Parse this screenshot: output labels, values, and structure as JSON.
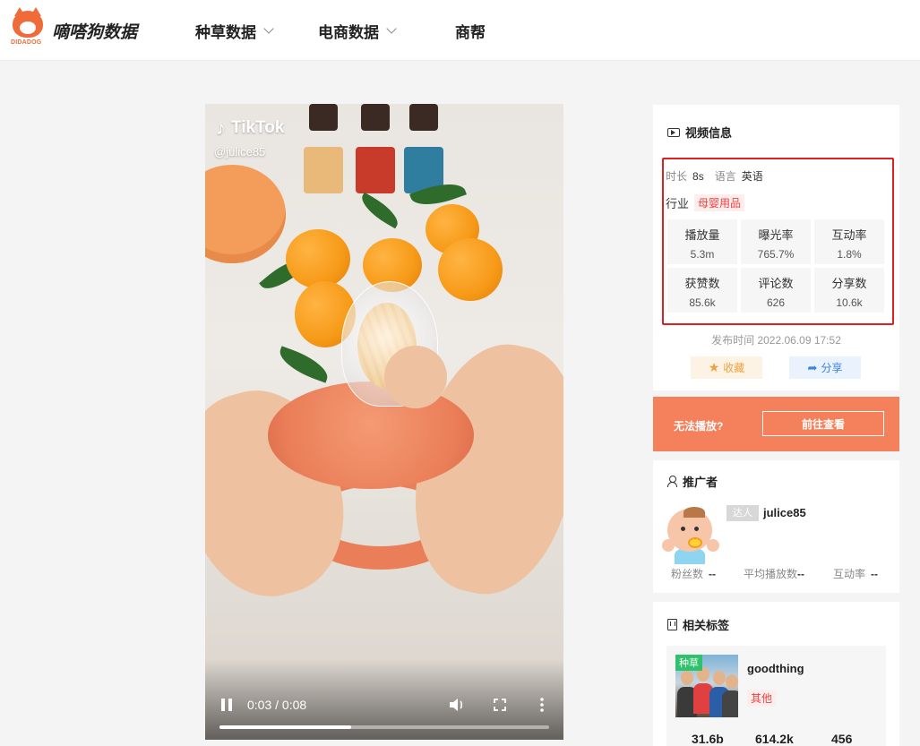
{
  "header": {
    "logo_text": "DIDADOG",
    "brand": "嘀嗒狗数据",
    "nav": [
      {
        "label": "种草数据"
      },
      {
        "label": "电商数据"
      },
      {
        "label": "商帮"
      }
    ]
  },
  "video": {
    "platform": "TikTok",
    "username": "@julice85",
    "time": "0:03 / 0:08",
    "progress": 0.4
  },
  "video_info": {
    "title": "视频信息",
    "duration_label": "时长",
    "duration": "8s",
    "language_label": "语言",
    "language": "英语",
    "industry_label": "行业",
    "industry": "母婴用品",
    "stats": [
      {
        "label": "播放量",
        "value": "5.3m"
      },
      {
        "label": "曝光率",
        "value": "765.7%"
      },
      {
        "label": "互动率",
        "value": "1.8%"
      },
      {
        "label": "获赞数",
        "value": "85.6k"
      },
      {
        "label": "评论数",
        "value": "626"
      },
      {
        "label": "分享数",
        "value": "10.6k"
      }
    ],
    "publish_time": "发布时间 2022.06.09 17:52",
    "favorite_label": "收藏",
    "share_label": "分享"
  },
  "promo": {
    "text": "无法播放?",
    "button": "前往查看"
  },
  "promoter": {
    "title": "推广者",
    "badge": "达人",
    "name": "julice85",
    "fans_label": "粉丝数",
    "fans": "--",
    "avg_play_label": "平均播放数",
    "avg_play": "--",
    "engagement_label": "互动率",
    "engagement": "--"
  },
  "related_tags": {
    "title": "相关标签",
    "items": [
      {
        "badge": "种草",
        "name": "goodthing",
        "category": "其他",
        "stats": [
          "31.6b",
          "614.2k",
          "456"
        ]
      }
    ]
  },
  "colors": {
    "accent": "#f4805c",
    "highlight_border": "#e02020",
    "tag_red": "#f04040",
    "badge_green": "#2dc26b"
  }
}
